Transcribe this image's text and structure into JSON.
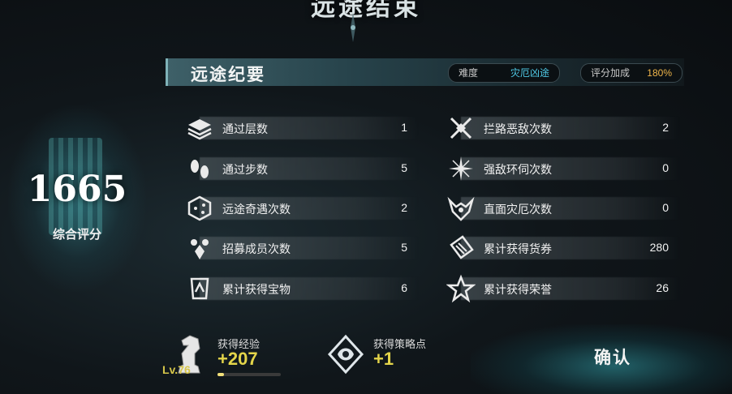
{
  "title": "远途结束",
  "score": {
    "value": "1665",
    "label": "综合评分"
  },
  "summary": {
    "title": "远途纪要",
    "difficulty": {
      "label": "难度",
      "value": "灾厄凶途"
    },
    "bonus": {
      "label": "评分加成",
      "value": "180%"
    }
  },
  "stats_left": [
    {
      "icon": "layers-icon",
      "label": "通过层数",
      "value": "1"
    },
    {
      "icon": "footprints-icon",
      "label": "通过步数",
      "value": "5"
    },
    {
      "icon": "dice-icon",
      "label": "远途奇遇次数",
      "value": "2"
    },
    {
      "icon": "recruit-icon",
      "label": "招募成员次数",
      "value": "5"
    },
    {
      "icon": "treasure-icon",
      "label": "累计获得宝物",
      "value": "6"
    }
  ],
  "stats_right": [
    {
      "icon": "crossed-swords-icon",
      "label": "拦路恶敌次数",
      "value": "2"
    },
    {
      "icon": "starburst-icon",
      "label": "强敌环伺次数",
      "value": "0"
    },
    {
      "icon": "demon-horns-icon",
      "label": "直面灾厄次数",
      "value": "0"
    },
    {
      "icon": "ticket-icon",
      "label": "累计获得货券",
      "value": "280"
    },
    {
      "icon": "honor-star-icon",
      "label": "累计获得荣誉",
      "value": "26"
    }
  ],
  "footer": {
    "exp": {
      "label": "获得经验",
      "value": "+207",
      "level": "Lv.76",
      "progress": 0.1
    },
    "strategy": {
      "label": "获得策略点",
      "value": "+1"
    },
    "confirm_label": "确认"
  },
  "colors": {
    "difficulty": "#4fc9e6",
    "bonus": "#f0b64a",
    "gain": "#e4d54a",
    "level": "#d6c64a"
  }
}
